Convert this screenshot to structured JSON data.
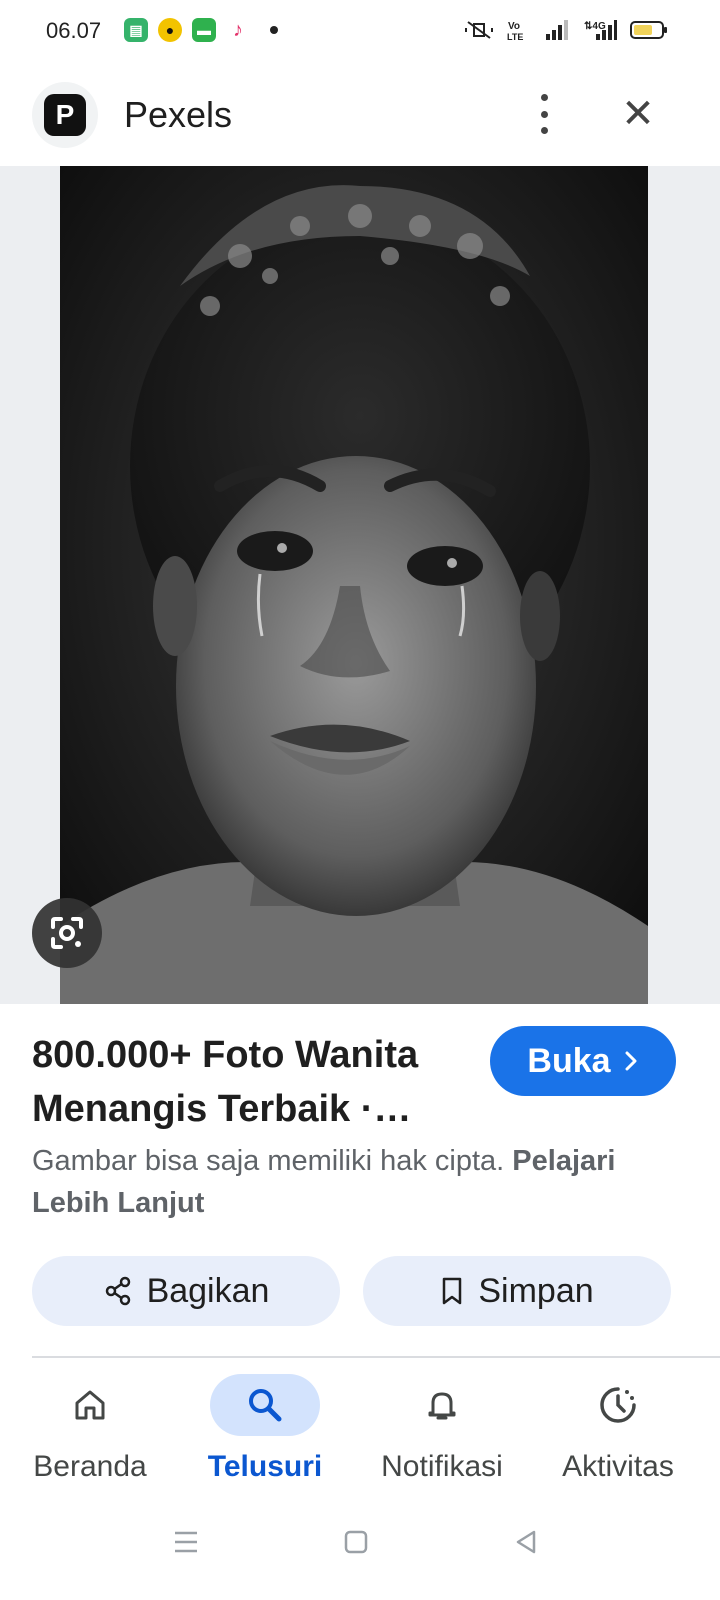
{
  "status_bar": {
    "time": "06.07",
    "notification_icons": [
      "app-icon-green",
      "app-icon-yellow",
      "chat-icon-green",
      "tiktok-icon"
    ],
    "system_icons": [
      "mute-vibrate-icon",
      "volte-icon",
      "signal-icon",
      "4g-signal-icon",
      "battery-icon"
    ],
    "battery_level": 0.7
  },
  "header": {
    "site_name": "Pexels",
    "logo_letter": "P"
  },
  "result": {
    "title": "800.000+ Foto Wanita Menangis Terbaik ·…",
    "open_button": "Buka",
    "copyright_notice": "Gambar bisa saja memiliki hak cipta.",
    "learn_more": "Pelajari Lebih Lanjut",
    "share_label": "Bagikan",
    "save_label": "Simpan"
  },
  "bottom_nav": {
    "items": [
      {
        "label": "Beranda",
        "icon": "home-icon",
        "active": false
      },
      {
        "label": "Telusuri",
        "icon": "search-icon",
        "active": true
      },
      {
        "label": "Notifikasi",
        "icon": "bell-icon",
        "active": false
      },
      {
        "label": "Aktivitas",
        "icon": "activity-icon",
        "active": false
      }
    ]
  },
  "colors": {
    "accent": "#1a73e8",
    "active_nav": "#0b57d0",
    "action_bg": "#e8eefa"
  }
}
